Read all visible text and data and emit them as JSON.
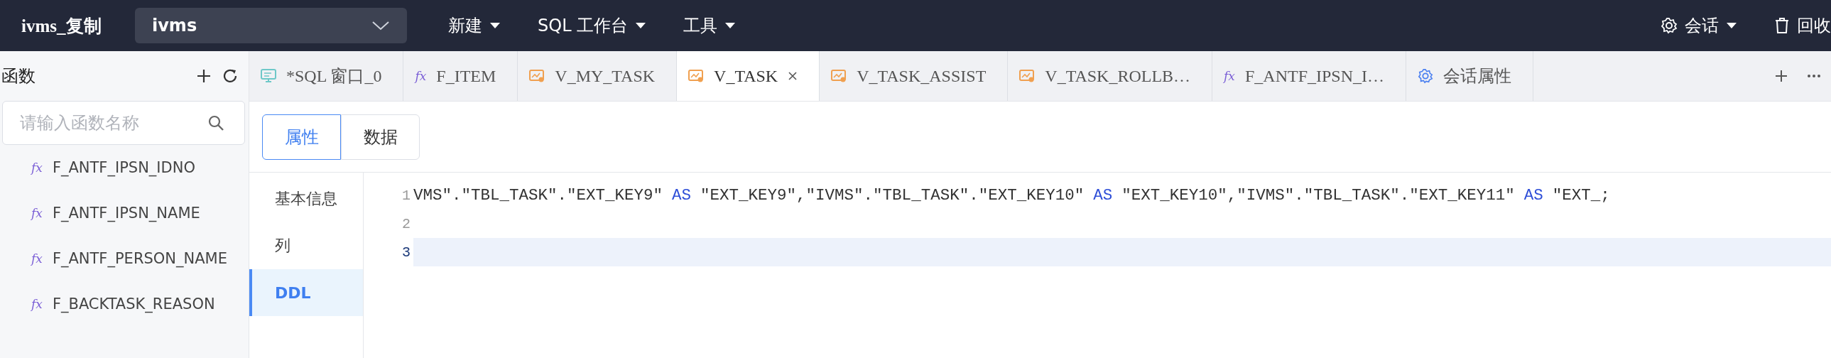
{
  "topbar": {
    "title": "ivms_复制",
    "connection": {
      "value": "ivms"
    },
    "menus": [
      {
        "label": "新建"
      },
      {
        "label": "SQL 工作台"
      },
      {
        "label": "工具"
      }
    ],
    "right": [
      {
        "kind": "session",
        "label": "会话",
        "caret": true
      },
      {
        "kind": "trash",
        "label": "回收",
        "caret": false
      }
    ]
  },
  "sidebar": {
    "title": "函数",
    "search": {
      "placeholder": "请输入函数名称"
    },
    "items": [
      {
        "icon": "fx",
        "label": "F_ANTF_IPSN_IDNO"
      },
      {
        "icon": "fx",
        "label": "F_ANTF_IPSN_NAME"
      },
      {
        "icon": "fx",
        "label": "F_ANTF_PERSON_NAME"
      },
      {
        "icon": "fx",
        "label": "F_BACKTASK_REASON"
      }
    ]
  },
  "tabs": [
    {
      "kind": "sql",
      "label": "*SQL 窗口_0",
      "selected": false
    },
    {
      "kind": "function",
      "icon": "fx",
      "label": "F_ITEM",
      "selected": false
    },
    {
      "kind": "view",
      "label": "V_MY_TASK",
      "selected": false
    },
    {
      "kind": "view",
      "label": "V_TASK",
      "selected": true
    },
    {
      "kind": "view",
      "label": "V_TASK_ASSIST",
      "selected": false
    },
    {
      "kind": "view",
      "label": "V_TASK_ROLLB…",
      "selected": false
    },
    {
      "kind": "function",
      "icon": "fx",
      "label": "F_ANTF_IPSN_I…",
      "selected": false
    },
    {
      "kind": "settings",
      "label": "会话属性",
      "selected": false
    }
  ],
  "view_tabs": [
    {
      "label": "属性",
      "selected": true
    },
    {
      "label": "数据",
      "selected": false
    }
  ],
  "sections": [
    {
      "label": "基本信息",
      "selected": false
    },
    {
      "label": "列",
      "selected": false
    },
    {
      "label": "DDL",
      "selected": true
    }
  ],
  "editor": {
    "lines": [
      {
        "number": "1",
        "current": false,
        "tokens": [
          {
            "kind": "string",
            "text": "VMS\".\"TBL_TASK\".\"EXT_KEY9\""
          },
          {
            "kind": "keyword",
            "text": "AS"
          },
          {
            "kind": "string",
            "text": "\"EXT_KEY9\",\"IVMS\".\"TBL_TASK\".\"EXT_KEY10\""
          },
          {
            "kind": "keyword",
            "text": "AS"
          },
          {
            "kind": "string",
            "text": "\"EXT_KEY10\",\"IVMS\".\"TBL_TASK\".\"EXT_KEY11\""
          },
          {
            "kind": "keyword",
            "text": "AS"
          },
          {
            "kind": "string",
            "text": "\"EXT_;"
          }
        ]
      },
      {
        "number": "2",
        "current": false
      },
      {
        "number": "3",
        "current": true
      }
    ]
  }
}
